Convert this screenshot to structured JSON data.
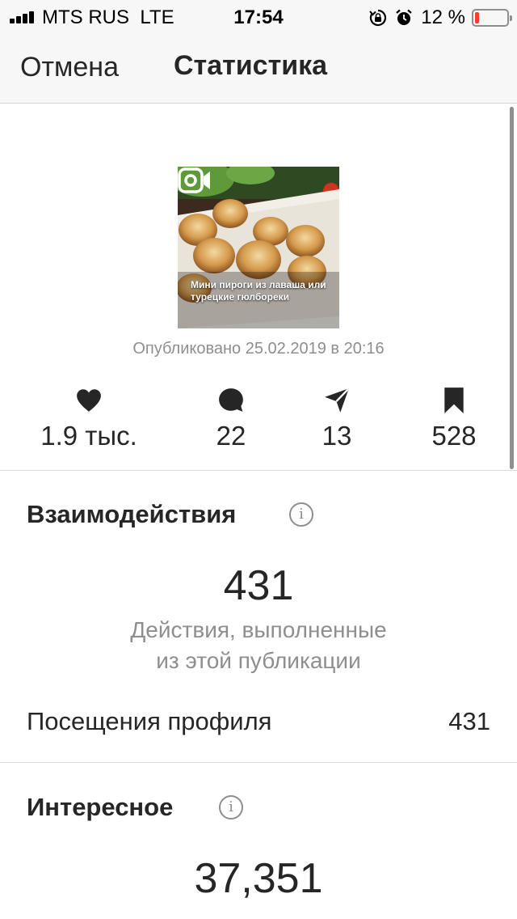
{
  "status_bar": {
    "carrier": "MTS RUS",
    "network": "LTE",
    "time": "17:54",
    "battery_percent": "12 %",
    "battery_level": 0.12,
    "battery_color": "#ff3b30"
  },
  "nav": {
    "cancel_label": "Отмена",
    "title": "Статистика"
  },
  "post": {
    "thumbnail_caption": "Мини пироги из лаваша или турецкие гюлбореки",
    "published": "Опубликовано 25.02.2019 в 20:16"
  },
  "metrics": {
    "likes": "1.9 тыс.",
    "comments": "22",
    "shares": "13",
    "saves": "528"
  },
  "interactions": {
    "title": "Взаимодействия",
    "total": "431",
    "description_line1": "Действия, выполненные",
    "description_line2": "из этой публикации",
    "profile_visits_label": "Посещения профиля",
    "profile_visits_value": "431"
  },
  "discovery": {
    "title": "Интересное",
    "total": "37,351"
  },
  "colors": {
    "text": "#262626",
    "secondary": "#8e8e8e",
    "divider": "#dbdbdb",
    "bar_background": "#f7f7f7"
  }
}
